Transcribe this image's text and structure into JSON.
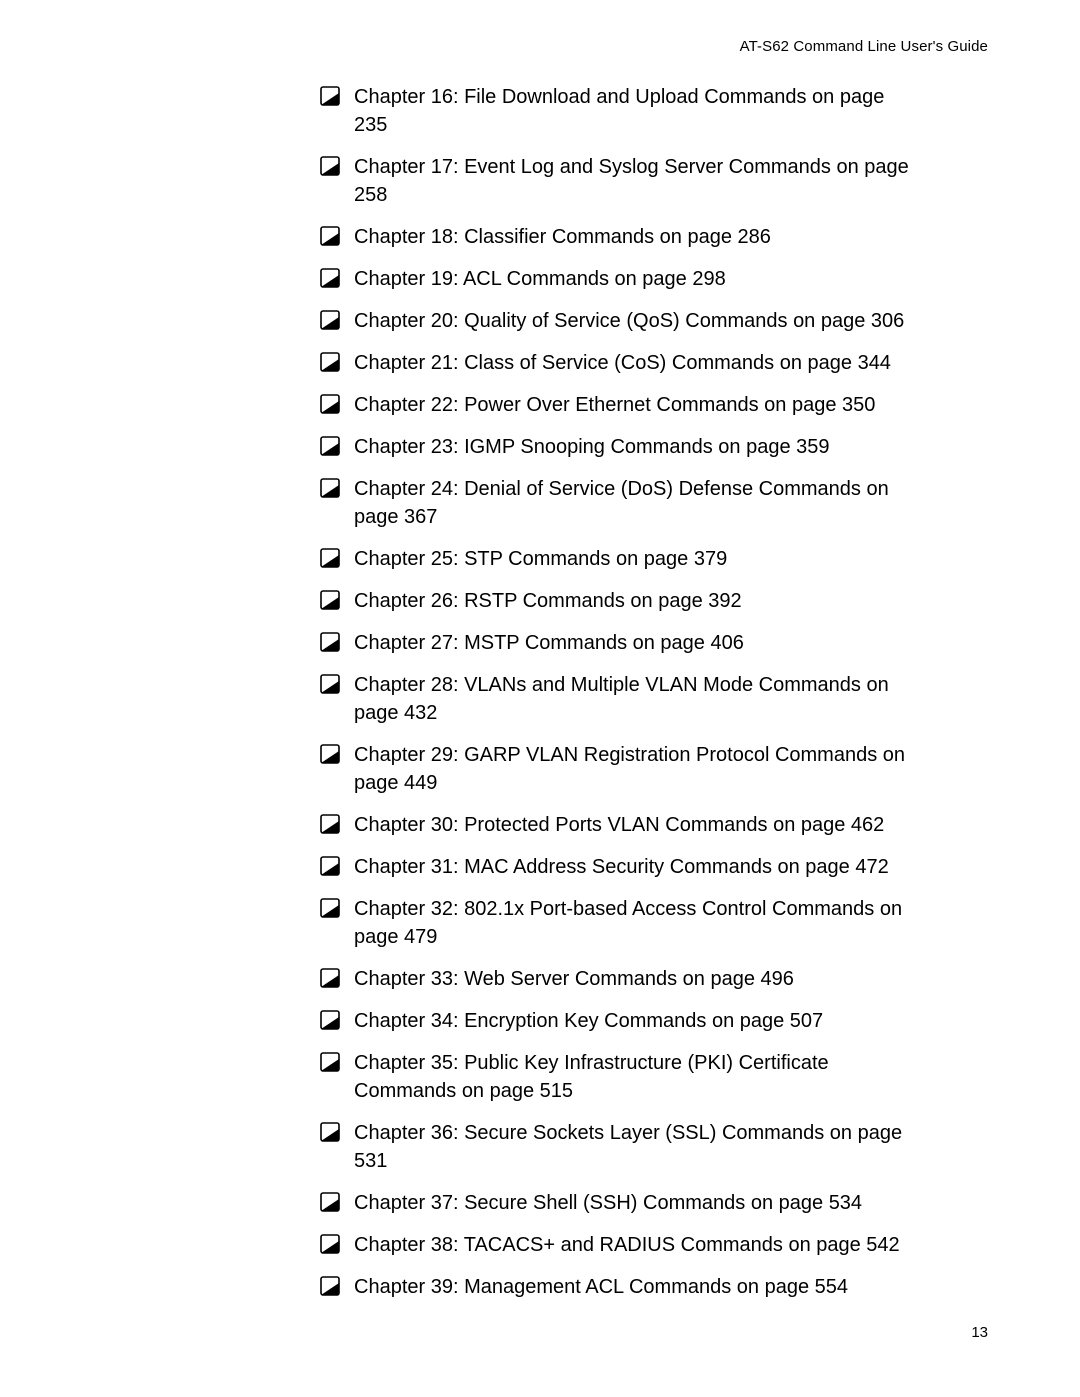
{
  "header": {
    "running_head": "AT-S62 Command Line User's Guide"
  },
  "toc": {
    "items": [
      {
        "text": "Chapter 16: File Download and Upload Commands on page 235"
      },
      {
        "text": "Chapter 17: Event Log and Syslog Server Commands on page 258"
      },
      {
        "text": "Chapter 18: Classifier Commands on page 286"
      },
      {
        "text": "Chapter 19: ACL Commands on page 298"
      },
      {
        "text": "Chapter 20: Quality of Service (QoS) Commands on page 306"
      },
      {
        "text": "Chapter 21: Class of Service (CoS) Commands on page 344"
      },
      {
        "text": "Chapter 22: Power Over Ethernet Commands on page 350"
      },
      {
        "text": "Chapter 23: IGMP Snooping Commands on page 359"
      },
      {
        "text": "Chapter 24: Denial of Service (DoS) Defense Commands on page 367"
      },
      {
        "text": "Chapter 25: STP Commands on page 379"
      },
      {
        "text": "Chapter 26: RSTP Commands on page 392"
      },
      {
        "text": "Chapter 27: MSTP Commands on page 406"
      },
      {
        "text": "Chapter 28: VLANs and Multiple VLAN Mode Commands on page 432"
      },
      {
        "text": "Chapter 29: GARP VLAN Registration Protocol Commands on page 449"
      },
      {
        "text": "Chapter 30: Protected Ports VLAN Commands on page 462"
      },
      {
        "text": "Chapter 31: MAC Address Security Commands on page 472"
      },
      {
        "text": "Chapter 32: 802.1x Port-based Access Control Commands on page 479"
      },
      {
        "text": "Chapter 33: Web Server Commands on page 496"
      },
      {
        "text": "Chapter 34: Encryption Key Commands on page 507"
      },
      {
        "text": "Chapter 35: Public Key Infrastructure (PKI) Certificate Commands on page 515"
      },
      {
        "text": "Chapter 36: Secure Sockets Layer (SSL) Commands on page 531"
      },
      {
        "text": "Chapter 37: Secure Shell (SSH) Commands on page 534"
      },
      {
        "text": "Chapter 38: TACACS+ and RADIUS Commands on page 542"
      },
      {
        "text": "Chapter 39: Management ACL Commands on page 554"
      }
    ]
  },
  "footer": {
    "page_number": "13"
  }
}
